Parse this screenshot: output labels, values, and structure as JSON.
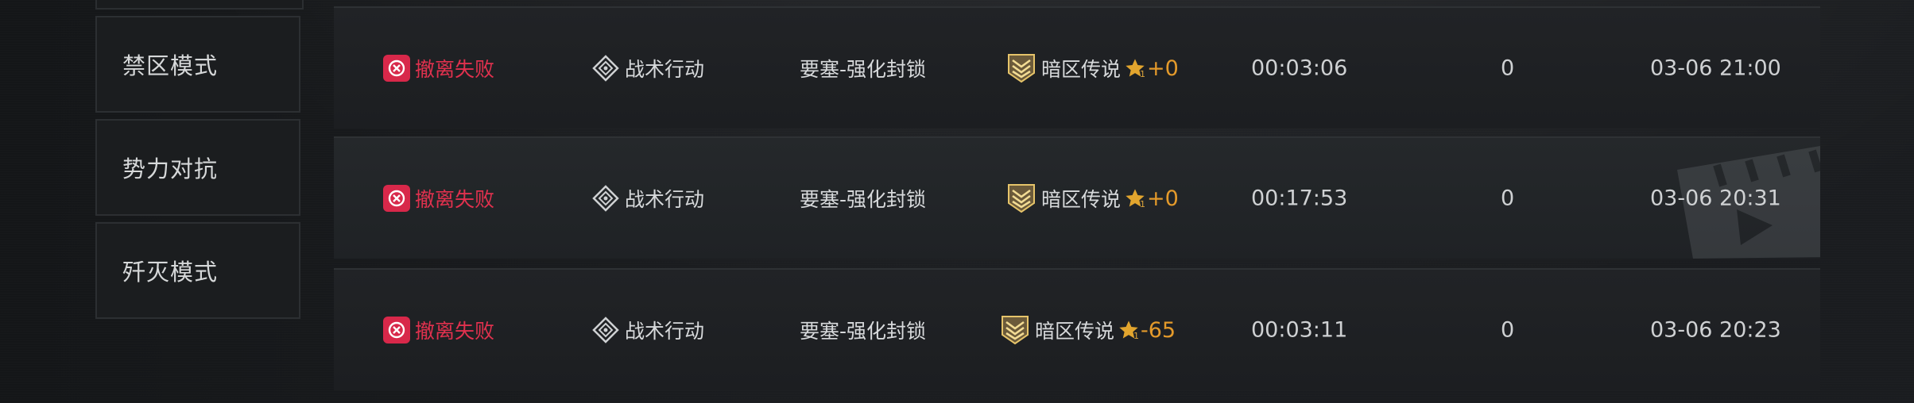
{
  "sidebar": {
    "items": [
      {
        "label": "禁区模式"
      },
      {
        "label": "势力对抗"
      },
      {
        "label": "歼灭模式"
      }
    ]
  },
  "records": [
    {
      "result": "撤离失败",
      "mode": "战术行动",
      "map": "要塞-强化封锁",
      "rank": "暗区传说",
      "star_level": "1",
      "delta": "+0",
      "duration": "00:03:06",
      "kills": "0",
      "time": "03-06 21:00"
    },
    {
      "result": "撤离失败",
      "mode": "战术行动",
      "map": "要塞-强化封锁",
      "rank": "暗区传说",
      "star_level": "1",
      "delta": "+0",
      "duration": "00:17:53",
      "kills": "0",
      "time": "03-06 20:31"
    },
    {
      "result": "撤离失败",
      "mode": "战术行动",
      "map": "要塞-强化封锁",
      "rank": "暗区传说",
      "star_level": "1",
      "delta": "-65",
      "duration": "00:03:11",
      "kills": "0",
      "time": "03-06 20:23"
    }
  ],
  "colors": {
    "fail": "#e0314e",
    "delta": "#e49a2b",
    "text": "#d7d9db"
  },
  "icons": {
    "result": "extraction-failed-icon",
    "mode": "tactical-op-diamond-icon",
    "rank": "chevron-rank-badge-icon",
    "star": "star-icon"
  }
}
